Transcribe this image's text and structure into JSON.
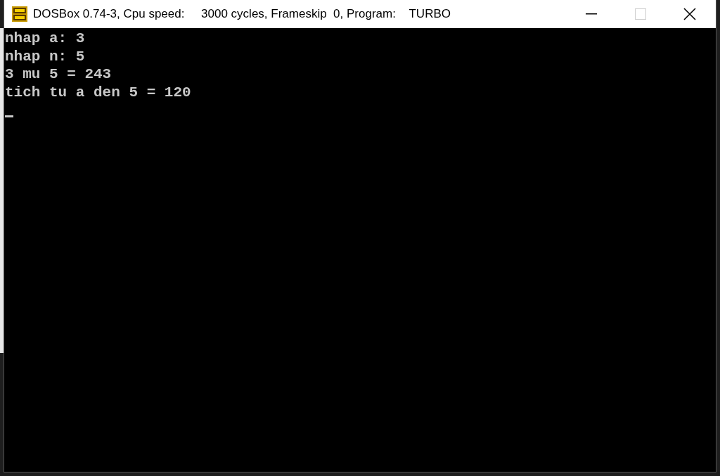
{
  "window": {
    "title": "DOSBox 0.74-3, Cpu speed:     3000 cycles, Frameskip  0, Program:    TURBO",
    "maximize_disabled": true
  },
  "console": {
    "lines": [
      "nhap a: 3",
      "nhap n: 5",
      "3 mu 5 = 243",
      "tich tu a den 5 = 120"
    ],
    "cursor_visible": true
  }
}
